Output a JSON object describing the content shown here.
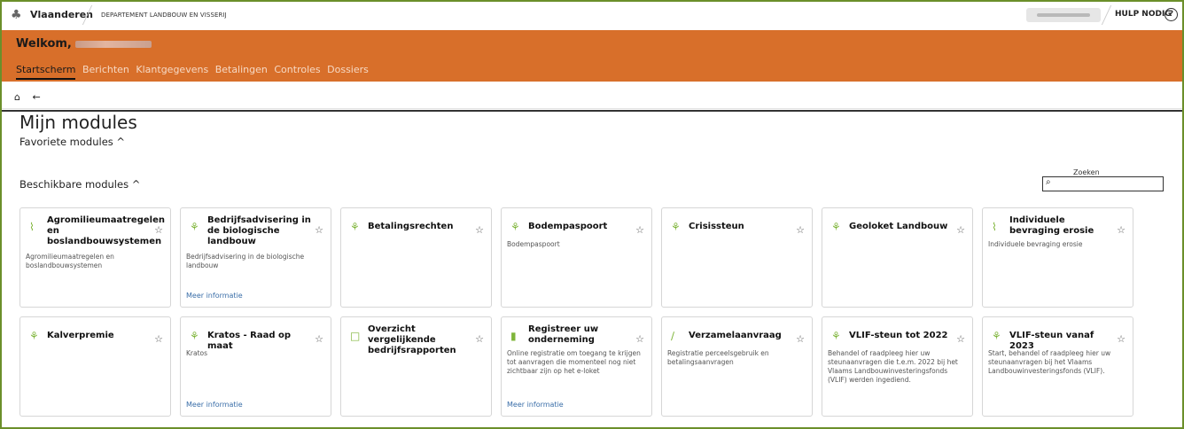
{
  "topbar": {
    "brand": "Vlaanderen",
    "department": "DEPARTEMENT LANDBOUW EN VISSERIJ",
    "help": "HULP NODIG",
    "help_symbol": "?"
  },
  "header": {
    "welcome": "Welkom,",
    "nav": [
      "Startscherm",
      "Berichten",
      "Klantgegevens",
      "Betalingen",
      "Controles",
      "Dossiers"
    ]
  },
  "crumbs": {
    "home": "⌂",
    "back": "←"
  },
  "page": {
    "title": "Mijn modules",
    "favorites": "Favoriete modules ^",
    "available": "Beschikbare modules ^"
  },
  "search": {
    "label": "Zoeken",
    "icon": "⌕"
  },
  "cards": [
    {
      "title": "Agromilieumaatregelen en boslandbouwsystemen",
      "desc": "Agromilieumaatregelen en boslandbouwsystemen",
      "more": "",
      "icon": "⌇"
    },
    {
      "title": "Bedrijfsadvisering in de biologische landbouw",
      "desc": "Bedrijfsadvisering in de biologische landbouw",
      "more": "Meer informatie",
      "icon": "⚘"
    },
    {
      "title": "Betalingsrechten",
      "desc": "",
      "more": "",
      "icon": "⚘"
    },
    {
      "title": "Bodempaspoort",
      "desc": "Bodempaspoort",
      "more": "",
      "icon": "⚘"
    },
    {
      "title": "Crisissteun",
      "desc": "",
      "more": "",
      "icon": "⚘"
    },
    {
      "title": "Geoloket Landbouw",
      "desc": "",
      "more": "",
      "icon": "⚘"
    },
    {
      "title": "Individuele bevraging erosie",
      "desc": "Individuele bevraging erosie",
      "more": "",
      "icon": "⌇"
    },
    {
      "title": "Kalverpremie",
      "desc": "",
      "more": "",
      "icon": "⚘"
    },
    {
      "title": "Kratos - Raad op maat",
      "desc": "Kratos",
      "more": "Meer informatie",
      "icon": "⚘"
    },
    {
      "title": "Overzicht vergelijkende bedrijfsrapporten",
      "desc": "",
      "more": "",
      "icon": "□"
    },
    {
      "title": "Registreer uw onderneming",
      "desc": "Online registratie om toegang te krijgen tot aanvragen die momenteel nog niet zichtbaar zijn op het e-loket",
      "more": "Meer informatie",
      "icon": "▮"
    },
    {
      "title": "Verzamelaanvraag",
      "desc": "Registratie perceelsgebruik en betalingsaanvragen",
      "more": "",
      "icon": "∕"
    },
    {
      "title": "VLIF-steun tot 2022",
      "desc": "Behandel of raadpleeg hier uw steunaanvragen die t.e.m. 2022 bij het Vlaams Landbouwinvesteringsfonds (VLIF) werden ingediend.",
      "more": "",
      "icon": "⚘"
    },
    {
      "title": "VLIF-steun vanaf 2023",
      "desc": "Start, behandel of raadpleeg hier uw steunaanvragen bij het Vlaams Landbouwinvesteringsfonds (VLIF).",
      "more": "",
      "icon": "⚘"
    }
  ],
  "colors": {
    "orange": "#d86f2a",
    "green": "#7fb53a",
    "link": "#3a6ea8"
  }
}
